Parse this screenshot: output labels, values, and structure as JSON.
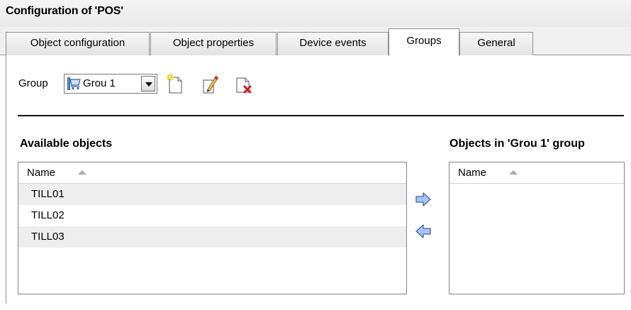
{
  "window": {
    "title": "Configuration of 'POS'"
  },
  "tabs": [
    {
      "label": "Object configuration"
    },
    {
      "label": "Object properties"
    },
    {
      "label": "Device events"
    },
    {
      "label": "Groups",
      "active": true
    },
    {
      "label": "General"
    }
  ],
  "group": {
    "label": "Group",
    "selected": "Grou 1",
    "icon": "shopping-cart-icon"
  },
  "toolbar": {
    "new_icon": "new-document-icon",
    "edit_icon": "edit-pencil-icon",
    "delete_icon": "delete-document-icon"
  },
  "available": {
    "title": "Available objects",
    "column": "Name",
    "rows": [
      "TILL01",
      "TILL02",
      "TILL03"
    ]
  },
  "in_group": {
    "title": "Objects in 'Grou 1' group",
    "column": "Name",
    "rows": []
  },
  "colors": {
    "arrow_fill": "#a9c4f0",
    "arrow_stroke": "#3a66b0",
    "row_alt": "#eeeeee"
  }
}
